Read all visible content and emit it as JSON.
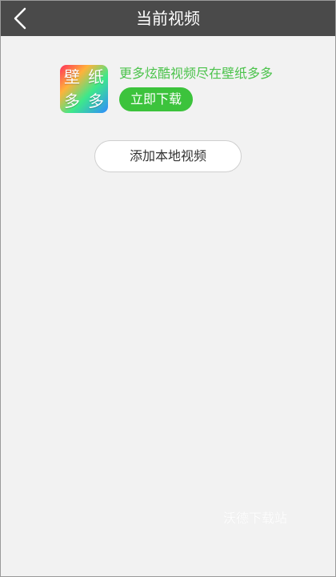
{
  "header": {
    "title": "当前视频",
    "back_icon": "chevron-left-icon"
  },
  "promo": {
    "logo_chars": [
      "壁",
      "纸",
      "多",
      "多"
    ],
    "text": "更多炫酷视频尽在壁纸多多",
    "download_label": "立即下载"
  },
  "actions": {
    "add_local_label": "添加本地视频"
  },
  "watermark": {
    "text": "沃德下载站"
  },
  "colors": {
    "header_bg": "#4a4a4a",
    "background": "#f2f2f2",
    "accent_green": "#3cc33c",
    "promo_text": "#4cc34c"
  }
}
